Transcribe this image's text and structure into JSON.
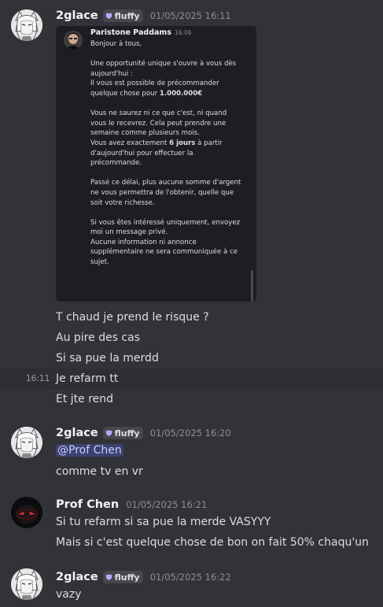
{
  "messages": [
    {
      "author": "2glace",
      "tag": "fluffy",
      "timestamp": "01/05/2025 16:11",
      "embed": {
        "author": "Paristone Paddams",
        "time": "16:06",
        "lines": [
          "Bonjour à tous,",
          "",
          "Une opportunité unique s'ouvre à vous dès",
          "aujourd'hui :",
          "Il vous est possible de précommander",
          "quelque chose pour ",
          "",
          "Vous ne saurez ni ce que c'est, ni quand",
          "vous le recevrez. Cela peut prendre une",
          "semaine comme plusieurs mois.",
          "Vous avez exactement ",
          "d'aujourd'hui pour effectuer la",
          "précommande.",
          "",
          "Passé ce délai, plus aucune somme d'argent",
          "ne vous permettra de l'obtenir, quelle que",
          "soit votre richesse.",
          "",
          "Si vous êtes intéressé uniquement, envoyez",
          "moi un message privé.",
          "Aucune information ni annonce",
          "supplémentaire ne sera communiquée à ce",
          "sujet."
        ],
        "price_bold": "1.000.000€",
        "days_bold": "6 jours",
        "days_after": " à partir"
      },
      "follow_ups": [
        "T chaud je prend le risque ?",
        "Au pire des cas",
        "Si sa pue la merdd",
        "Je refarm tt",
        "Et jte rend"
      ],
      "hover_time": "16:11"
    },
    {
      "author": "2glace",
      "tag": "fluffy",
      "timestamp": "01/05/2025 16:20",
      "mention": "@Prof Chen",
      "text": "comme tv en vr"
    },
    {
      "author": "Prof Chen",
      "timestamp": "01/05/2025 16:21",
      "lines": [
        "Si tu refarm si sa pue la merde VASYYY",
        "Mais si c'est quelque chose de bon on fait 50% chaqu'un"
      ]
    },
    {
      "author": "2glace",
      "tag": "fluffy",
      "timestamp": "01/05/2025 16:22",
      "text": "vazy"
    }
  ],
  "colors": {
    "background": "#323339",
    "mention_bg": "#3c4270",
    "tag_icon": "#b9a8ff"
  },
  "icons": {
    "tag": "fluffy-tag-icon"
  }
}
